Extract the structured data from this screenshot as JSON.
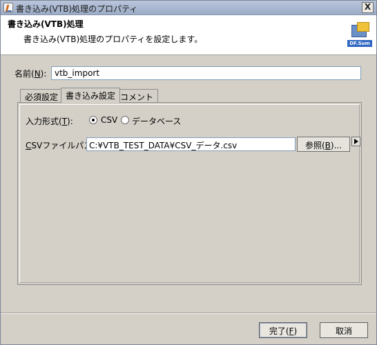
{
  "window": {
    "title": "書き込み(VTB)処理のプロパティ",
    "close_glyph": "X"
  },
  "header": {
    "title": "書き込み(VTB)処理",
    "description": "書き込み(VTB)処理のプロパティを設定します。",
    "logo_text": "DF.Sum"
  },
  "name_field": {
    "label_prefix": "名前(",
    "label_mnemonic": "N",
    "label_suffix": "):",
    "value": "vtb_import"
  },
  "tabs": [
    {
      "label": "必須設定",
      "active": false
    },
    {
      "label": "書き込み設定",
      "active": true
    },
    {
      "label": "コメント",
      "active": false
    }
  ],
  "write_settings": {
    "format_label_prefix": "入力形式(",
    "format_label_mnemonic": "T",
    "format_label_suffix": "):",
    "format_options": [
      {
        "label": "CSV",
        "selected": true
      },
      {
        "label": "データベース",
        "selected": false
      }
    ],
    "csv_label_mnemonic": "C",
    "csv_label_rest": "SVファイルパス:",
    "csv_path": "C:¥VTB_TEST_DATA¥CSV_データ.csv",
    "browse_prefix": "参照(",
    "browse_mnemonic": "B",
    "browse_suffix": ")..."
  },
  "buttons": {
    "finish_prefix": "完了(",
    "finish_mnemonic": "F",
    "finish_suffix": ")",
    "cancel_label": "取消"
  }
}
